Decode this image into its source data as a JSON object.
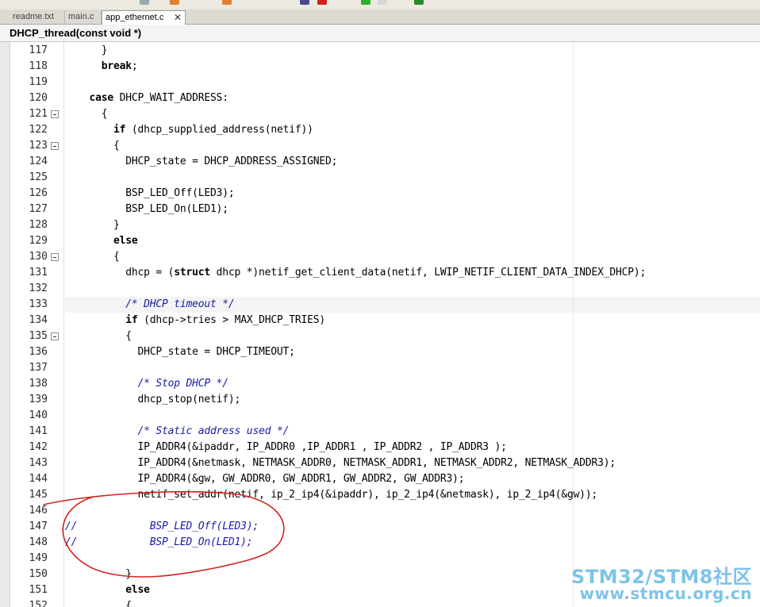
{
  "tabs": [
    {
      "label": "readme.txt",
      "active": false
    },
    {
      "label": "main.c",
      "active": false
    },
    {
      "label": "app_ethernet.c",
      "active": true
    }
  ],
  "function_bar": {
    "label": "DHCP_thread(const void *)"
  },
  "editor": {
    "lines": [
      {
        "num": "117",
        "fold": false,
        "tokens": [
          [
            "p",
            "      }"
          ]
        ]
      },
      {
        "num": "118",
        "fold": false,
        "tokens": [
          [
            "p",
            "      "
          ],
          [
            "k",
            "break"
          ],
          [
            "p",
            ";"
          ]
        ]
      },
      {
        "num": "119",
        "fold": false,
        "tokens": [
          [
            "p",
            ""
          ]
        ]
      },
      {
        "num": "120",
        "fold": false,
        "tokens": [
          [
            "p",
            "    "
          ],
          [
            "k",
            "case"
          ],
          [
            "p",
            " DHCP_WAIT_ADDRESS:"
          ]
        ]
      },
      {
        "num": "121",
        "fold": true,
        "tokens": [
          [
            "p",
            "      {"
          ]
        ]
      },
      {
        "num": "122",
        "fold": false,
        "tokens": [
          [
            "p",
            "        "
          ],
          [
            "k",
            "if"
          ],
          [
            "p",
            " (dhcp_supplied_address(netif))"
          ]
        ]
      },
      {
        "num": "123",
        "fold": true,
        "tokens": [
          [
            "p",
            "        {"
          ]
        ]
      },
      {
        "num": "124",
        "fold": false,
        "tokens": [
          [
            "p",
            "          DHCP_state = DHCP_ADDRESS_ASSIGNED;"
          ]
        ]
      },
      {
        "num": "125",
        "fold": false,
        "tokens": [
          [
            "p",
            ""
          ]
        ]
      },
      {
        "num": "126",
        "fold": false,
        "tokens": [
          [
            "p",
            "          BSP_LED_Off(LED3);"
          ]
        ]
      },
      {
        "num": "127",
        "fold": false,
        "tokens": [
          [
            "p",
            "          BSP_LED_On(LED1);"
          ]
        ]
      },
      {
        "num": "128",
        "fold": false,
        "tokens": [
          [
            "p",
            "        }"
          ]
        ]
      },
      {
        "num": "129",
        "fold": false,
        "tokens": [
          [
            "p",
            "        "
          ],
          [
            "k",
            "else"
          ]
        ]
      },
      {
        "num": "130",
        "fold": true,
        "tokens": [
          [
            "p",
            "        {"
          ]
        ]
      },
      {
        "num": "131",
        "fold": false,
        "tokens": [
          [
            "p",
            "          dhcp = ("
          ],
          [
            "k",
            "struct"
          ],
          [
            "p",
            " dhcp *)netif_get_client_data(netif, LWIP_NETIF_CLIENT_DATA_INDEX_DHCP);"
          ]
        ]
      },
      {
        "num": "132",
        "fold": false,
        "tokens": [
          [
            "p",
            ""
          ]
        ]
      },
      {
        "num": "133",
        "fold": false,
        "tokens": [
          [
            "p",
            "          "
          ],
          [
            "c",
            "/* DHCP timeout */"
          ]
        ]
      },
      {
        "num": "134",
        "fold": false,
        "tokens": [
          [
            "p",
            "          "
          ],
          [
            "k",
            "if"
          ],
          [
            "p",
            " (dhcp->tries > MAX_DHCP_TRIES)"
          ]
        ]
      },
      {
        "num": "135",
        "fold": true,
        "tokens": [
          [
            "p",
            "          {"
          ]
        ]
      },
      {
        "num": "136",
        "fold": false,
        "tokens": [
          [
            "p",
            "            DHCP_state = DHCP_TIMEOUT;"
          ]
        ]
      },
      {
        "num": "137",
        "fold": false,
        "tokens": [
          [
            "p",
            ""
          ]
        ]
      },
      {
        "num": "138",
        "fold": false,
        "tokens": [
          [
            "p",
            "            "
          ],
          [
            "c",
            "/* Stop DHCP */"
          ]
        ]
      },
      {
        "num": "139",
        "fold": false,
        "tokens": [
          [
            "p",
            "            dhcp_stop(netif);"
          ]
        ]
      },
      {
        "num": "140",
        "fold": false,
        "tokens": [
          [
            "p",
            ""
          ]
        ]
      },
      {
        "num": "141",
        "fold": false,
        "tokens": [
          [
            "p",
            "            "
          ],
          [
            "c",
            "/* Static address used */"
          ]
        ]
      },
      {
        "num": "142",
        "fold": false,
        "tokens": [
          [
            "p",
            "            IP_ADDR4(&ipaddr, IP_ADDR0 ,IP_ADDR1 , IP_ADDR2 , IP_ADDR3 );"
          ]
        ]
      },
      {
        "num": "143",
        "fold": false,
        "tokens": [
          [
            "p",
            "            IP_ADDR4(&netmask, NETMASK_ADDR0, NETMASK_ADDR1, NETMASK_ADDR2, NETMASK_ADDR3);"
          ]
        ]
      },
      {
        "num": "144",
        "fold": false,
        "tokens": [
          [
            "p",
            "            IP_ADDR4(&gw, GW_ADDR0, GW_ADDR1, GW_ADDR2, GW_ADDR3);"
          ]
        ]
      },
      {
        "num": "145",
        "fold": false,
        "tokens": [
          [
            "p",
            "            netif_set_addr(netif, ip_2_ip4(&ipaddr), ip_2_ip4(&netmask), ip_2_ip4(&gw));"
          ]
        ]
      },
      {
        "num": "146",
        "fold": false,
        "tokens": [
          [
            "p",
            ""
          ]
        ]
      },
      {
        "num": "147",
        "fold": false,
        "tokens": [
          [
            "c",
            "//            BSP_LED_Off(LED3);"
          ]
        ]
      },
      {
        "num": "148",
        "fold": false,
        "tokens": [
          [
            "c",
            "//            BSP_LED_On(LED1);"
          ]
        ]
      },
      {
        "num": "149",
        "fold": false,
        "tokens": [
          [
            "p",
            ""
          ]
        ]
      },
      {
        "num": "150",
        "fold": false,
        "tokens": [
          [
            "p",
            "          }"
          ]
        ]
      },
      {
        "num": "151",
        "fold": false,
        "tokens": [
          [
            "p",
            "          "
          ],
          [
            "k",
            "else"
          ]
        ]
      },
      {
        "num": "152",
        "fold": false,
        "tokens": [
          [
            "p",
            "          {"
          ]
        ]
      }
    ]
  },
  "colors": {
    "comment": "#1a1aa6",
    "annotation": "#d42020",
    "watermark": "#7ec3e8"
  },
  "watermark": {
    "line1": "STM32/STM8社区",
    "line2": "www.stmcu.org.cn"
  }
}
